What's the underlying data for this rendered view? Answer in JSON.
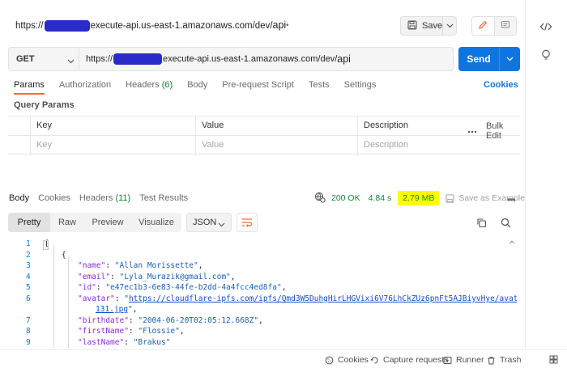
{
  "title_bar": {
    "url_prefix": "https://",
    "url_suffix": "execute-api.us-east-1.amazonaws.com/dev/",
    "url_tail": "api",
    "dot": "•",
    "save_label": "Save"
  },
  "request": {
    "method": "GET",
    "url_prefix": "https://",
    "url_suffix": "execute-api.us-east-1.amazonaws.com/dev/",
    "url_tail": "api",
    "send_label": "Send"
  },
  "request_tabs": {
    "params": "Params",
    "authorization": "Authorization",
    "headers": "Headers",
    "headers_count": "(6)",
    "body": "Body",
    "prerequest": "Pre-request Script",
    "tests": "Tests",
    "settings": "Settings",
    "cookies": "Cookies"
  },
  "query_params": {
    "section_label": "Query Params",
    "headers": [
      "Key",
      "Value",
      "Description"
    ],
    "placeholders": [
      "Key",
      "Value",
      "Description"
    ],
    "bulk_edit": "Bulk Edit"
  },
  "response": {
    "tabs": {
      "body": "Body",
      "cookies": "Cookies",
      "headers": "Headers",
      "headers_count": "(11)",
      "test_results": "Test Results"
    },
    "status": "200 OK",
    "time": "4.84 s",
    "size": "2.79 MB",
    "save_example": "Save as Example",
    "view_modes": [
      "Pretty",
      "Raw",
      "Preview",
      "Visualize"
    ],
    "format": "JSON",
    "line_numbers": [
      "1",
      "2",
      "3",
      "4",
      "5",
      "6",
      "",
      "7",
      "8",
      "9"
    ],
    "json": {
      "open_bracket": "[",
      "open_brace": "{",
      "name_key": "\"name\"",
      "name_val": "\"Allan Morissette\"",
      "email_key": "\"email\"",
      "email_val": "\"Lyla_Murazik@gmail.com\"",
      "id_key": "\"id\"",
      "id_val": "\"e47ec1b3-6e83-44fe-b2dd-4a4fcc4ed8fa\"",
      "avatar_key": "\"avatar\"",
      "avatar_url_1": "https://cloudflare-ipfs.com/ipfs/Qmd3W5DuhgHirLHGVixi6V76LhCkZUz6pnFt5AJBiyvHye/avatar/",
      "avatar_url_2": "131.jpg",
      "birthdate_key": "\"birthdate\"",
      "birthdate_val": "\"2004-06-20T02:05:12.668Z\"",
      "firstname_key": "\"firstName\"",
      "firstname_val": "\"Flossie\"",
      "lastname_key": "\"lastName\"",
      "lastname_val": "\"Brakus\""
    }
  },
  "status_bar": {
    "cookies": "Cookies",
    "capture": "Capture requests",
    "runner": "Runner",
    "trash": "Trash"
  },
  "colors": {
    "send": "#0e75e0",
    "status_green": "#0c8c3a",
    "highlight": "#ffff00",
    "active_tab": "#f26b3a",
    "redaction": "#2a2bc9"
  }
}
